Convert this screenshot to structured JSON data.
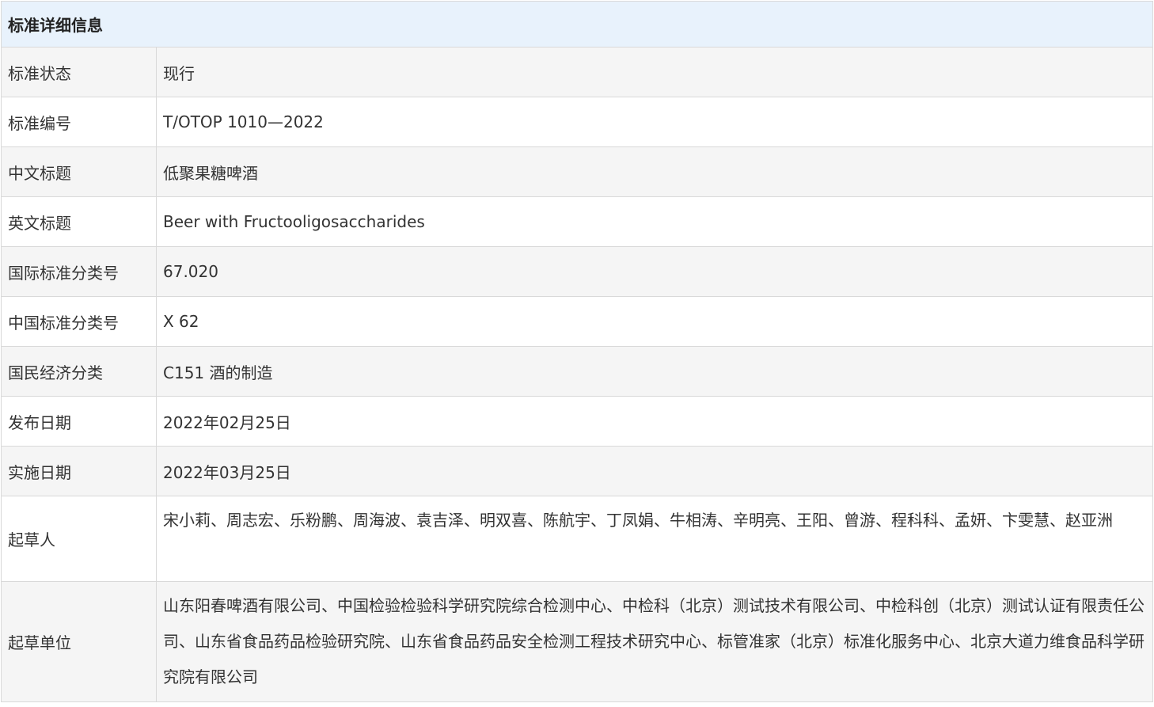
{
  "header": {
    "title": "标准详细信息"
  },
  "rows": [
    {
      "label": "标准状态",
      "value": "现行"
    },
    {
      "label": "标准编号",
      "value": "T/OTOP 1010—2022"
    },
    {
      "label": "中文标题",
      "value": "低聚果糖啤酒"
    },
    {
      "label": "英文标题",
      "value": "Beer with Fructooligosaccharides"
    },
    {
      "label": "国际标准分类号",
      "value": "67.020"
    },
    {
      "label": "中国标准分类号",
      "value": "X 62"
    },
    {
      "label": "国民经济分类",
      "value": "C151 酒的制造"
    },
    {
      "label": "发布日期",
      "value": "2022年02月25日"
    },
    {
      "label": "实施日期",
      "value": "2022年03月25日"
    },
    {
      "label": "起草人",
      "value": "宋小莉、周志宏、乐粉鹏、周海波、袁吉泽、明双喜、陈航宇、丁凤娟、牛相涛、辛明亮、王阳、曾游、程科科、孟妍、卞雯慧、赵亚洲"
    },
    {
      "label": "起草单位",
      "value": "山东阳春啤酒有限公司、中国检验检验科学研究院综合检测中心、中检科（北京）测试技术有限公司、中检科创（北京）测试认证有限责任公司、山东省食品药品检验研究院、山东省食品药品安全检测工程技术研究中心、标管准家（北京）标准化服务中心、北京大道力维食品科学研究院有限公司"
    }
  ]
}
